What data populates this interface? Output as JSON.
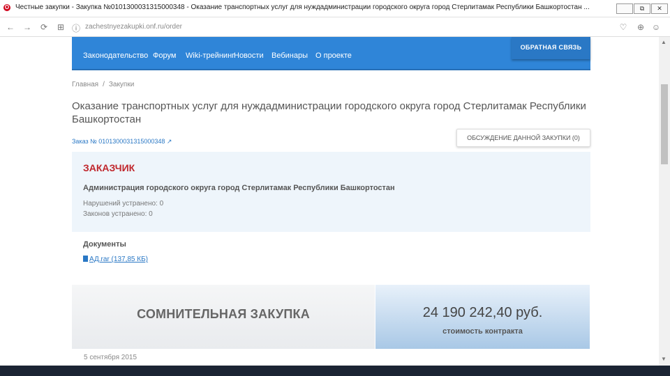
{
  "window": {
    "title": "Честные закупки - Закупка №0101300031315000348 - Оказание транспортных услуг для нуждадминистрации городского округа город Стерлитамак Республики Башкортостан ...",
    "btn_minimize": "",
    "btn_restore": "⧉",
    "btn_close": "✕",
    "app_icon_letter": "O"
  },
  "browser": {
    "url": "zachestnyezakupki.onf.ru/order",
    "back_glyph": "←",
    "forward_glyph": "→",
    "reload_glyph": "⟳",
    "grid_glyph": "⊞",
    "info_glyph": "ⓘ",
    "heart_glyph": "♡",
    "download_glyph": "⊕",
    "user_glyph": "☺"
  },
  "nav": {
    "items": [
      "Законодательство",
      "Форум",
      "Wiki-трейнинг",
      "Новости",
      "Вебинары",
      "О проекте"
    ],
    "feedback": "ОБРАТНАЯ СВЯЗЬ"
  },
  "breadcrumb": {
    "home": "Главная",
    "sep": "/",
    "current": "Закупки"
  },
  "purchase": {
    "title": "Оказание транспортных услуг для нуждадминистрации городского округа город Стерлитамак Республики Башкортостан",
    "order_number": "Заказ № 0101300031315000348 ↗",
    "discuss_button": "ОБСУЖДЕНИЕ ДАННОЙ ЗАКУПКИ (0)"
  },
  "customer": {
    "label": "ЗАКАЗЧИК",
    "name": "Администрация городского округа город Стерлитамак Республики Башкортостан",
    "violations": "Нарушений устранено: 0",
    "laws": "Законов устранено: 0"
  },
  "documents": {
    "label": "Документы",
    "file": "АД.rar (137,85 КБ)"
  },
  "status": {
    "suspicious": "СОМНИТЕЛЬНАЯ ЗАКУПКА"
  },
  "price": {
    "amount": "24 190 242,40 руб.",
    "label": "стоимость контракта"
  },
  "date": "5 сентября 2015",
  "colors": {
    "nav_blue": "#2f85d8",
    "customer_red": "#c0272d",
    "panel_bg": "#eef5fb"
  }
}
